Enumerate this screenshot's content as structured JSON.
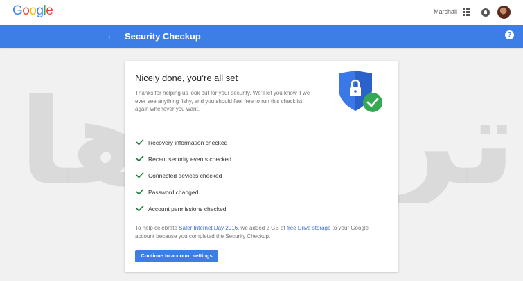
{
  "header": {
    "logo_letters": [
      {
        "ch": "G",
        "color": "#4285F4"
      },
      {
        "ch": "o",
        "color": "#EA4335"
      },
      {
        "ch": "o",
        "color": "#FBBC05"
      },
      {
        "ch": "g",
        "color": "#4285F4"
      },
      {
        "ch": "l",
        "color": "#34A853"
      },
      {
        "ch": "e",
        "color": "#EA4335"
      }
    ],
    "user_name": "Marshall",
    "icons": [
      "apps-icon",
      "notifications-icon",
      "avatar"
    ]
  },
  "page_bar": {
    "back_glyph": "←",
    "title": "Security Checkup",
    "help_glyph": "?",
    "color": "#3d7ee6"
  },
  "card": {
    "headline": "Nicely done, you’re all set",
    "intro": "Thanks for helping us look out for your security. We’ll let you know if we ever see anything fishy, and you should feel free to run this checklist again whenever you want.",
    "shield_icon": "shield-lock-check-icon",
    "checklist": [
      {
        "label": "Recovery information checked"
      },
      {
        "label": "Recent security events checked"
      },
      {
        "label": "Connected devices checked"
      },
      {
        "label": "Password changed"
      },
      {
        "label": "Account permissions checked"
      }
    ],
    "footer": {
      "prefix": "To help celebrate ",
      "link1": "Safer Internet Day 2016",
      "middle": ", we added 2 GB of ",
      "link2": "free Drive storage",
      "suffix": " to your Google account because you completed the Security Checkup."
    },
    "continue_label": "Continue to account settings"
  },
  "watermark": {
    "text": "ترفندها",
    "color": "#d9d9d9"
  }
}
